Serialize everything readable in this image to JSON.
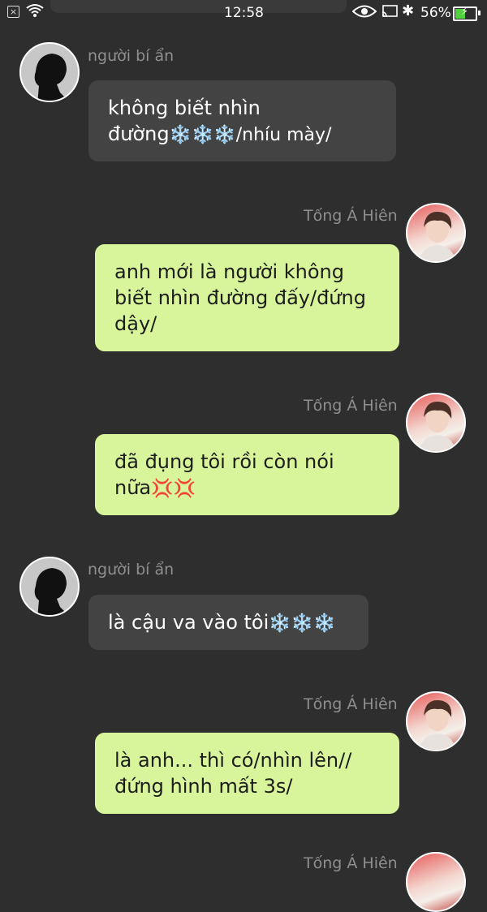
{
  "status_bar": {
    "time": "12:58",
    "battery_percent": "56%",
    "battery_level": 0.56,
    "icons": [
      "close-box-icon",
      "wifi-icon",
      "eye-icon",
      "cast-icon",
      "bluetooth-icon",
      "battery-icon"
    ]
  },
  "messages": [
    {
      "sender": "người bí ẩn",
      "side": "left",
      "text": "không biết nhìn đường",
      "suffix": "❄️❄️❄️/nhíu mày/"
    },
    {
      "sender": "Tống Á Hiên",
      "side": "right",
      "text": "anh mới là người không biết nhìn đường đấy/đứng dậy/"
    },
    {
      "sender": "Tống Á Hiên",
      "side": "right",
      "text": "đã đụng tôi rồi còn nói nữa",
      "suffix": "💢💢"
    },
    {
      "sender": "người bí ẩn",
      "side": "left",
      "text": "là cậu va vào tôi",
      "suffix": "❄️❄️❄️"
    },
    {
      "sender": "Tống Á Hiên",
      "side": "right",
      "text": "là anh... thì có/nhìn lên// đứng hình mất 3s/"
    },
    {
      "sender": "Tống Á Hiên",
      "side": "right",
      "text": ""
    }
  ],
  "colors": {
    "background": "#2e2e2e",
    "left_bubble": "#434343",
    "right_bubble": "#d8f59b",
    "sender_name": "#8f8f8f"
  }
}
